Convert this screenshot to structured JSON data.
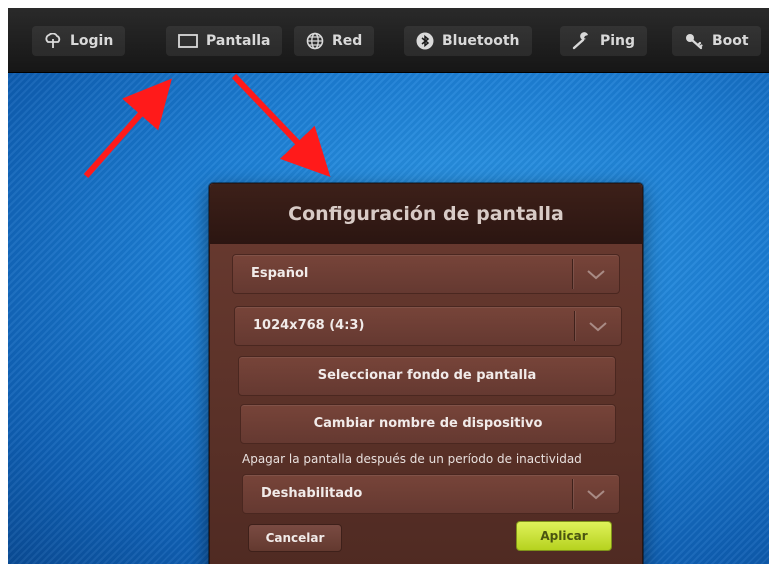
{
  "nav": {
    "items": [
      {
        "label": "Login",
        "icon": "cloud-login-icon"
      },
      {
        "label": "Pantalla",
        "icon": "monitor-icon"
      },
      {
        "label": "Red",
        "icon": "globe-icon"
      },
      {
        "label": "Bluetooth",
        "icon": "bluetooth-icon"
      },
      {
        "label": "Ping",
        "icon": "wrench-icon"
      },
      {
        "label": "Boot",
        "icon": "key-icon"
      }
    ]
  },
  "dialog": {
    "title": "Configuración de pantalla",
    "language_select": {
      "value": "Español"
    },
    "resolution_select": {
      "value": "1024x768 (4:3)"
    },
    "wallpaper_button": "Seleccionar fondo de pantalla",
    "rename_button": "Cambiar nombre de dispositivo",
    "screen_off_prompt": "Apagar la pantalla después de un período de inactividad",
    "screen_off_select": {
      "value": "Deshabilitado"
    },
    "cancel_button": "Cancelar",
    "apply_button": "Aplicar"
  },
  "colors": {
    "annotation_arrow": "#ff1a1a",
    "apply_accent": "#c8e03a",
    "dialog_background": "#5f342b",
    "desktop_background": "#1c7ed4"
  }
}
